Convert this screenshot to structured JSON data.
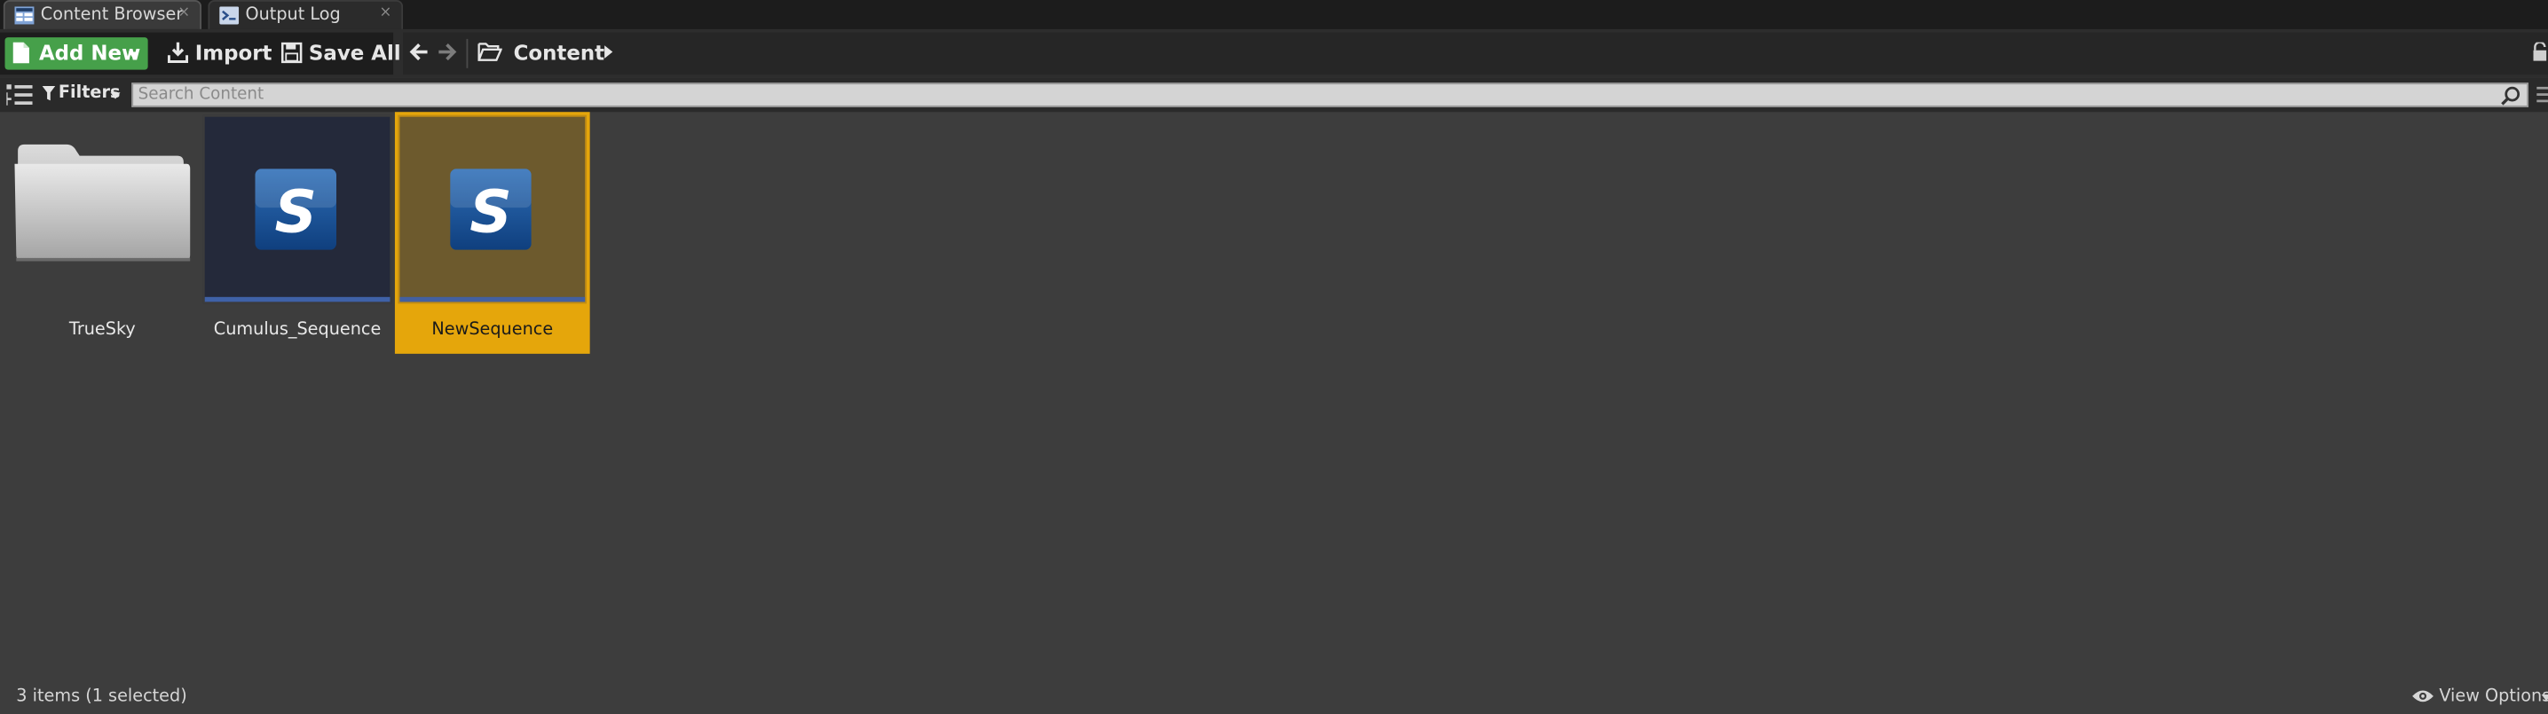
{
  "tabs": [
    {
      "label": "Content Browser",
      "icon": "content-browser-icon",
      "close": "×",
      "active": true
    },
    {
      "label": "Output Log",
      "icon": "output-log-icon",
      "close": "×",
      "active": false
    }
  ],
  "toolbar": {
    "add_new_label": "Add New",
    "import_label": "Import",
    "save_all_label": "Save All",
    "breadcrumb": [
      "Content"
    ]
  },
  "search": {
    "filters_label": "Filters",
    "placeholder": "Search Content"
  },
  "assets": [
    {
      "name": "TrueSky",
      "type": "folder",
      "selected": false
    },
    {
      "name": "Cumulus_Sequence",
      "type": "level-sequence",
      "selected": false
    },
    {
      "name": "NewSequence",
      "type": "level-sequence",
      "selected": true
    }
  ],
  "status": {
    "items_text": "3 items (1 selected)",
    "view_options_label": "View Options"
  },
  "colors": {
    "accent_green": "#46a04a",
    "selection": "#e5a60b",
    "background": "#3d3d3d"
  }
}
